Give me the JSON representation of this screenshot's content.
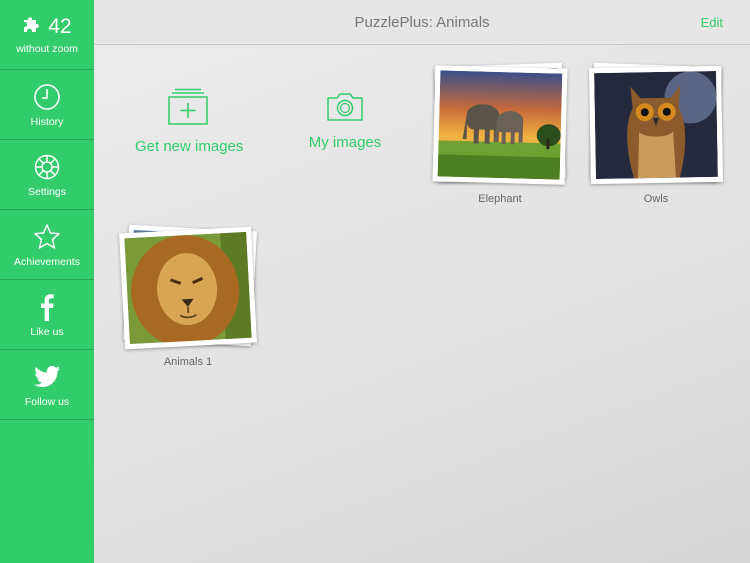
{
  "sidebar": {
    "score": {
      "value": "42",
      "label": "without zoom",
      "icon": "puzzle-piece-icon"
    },
    "items": [
      {
        "label": "History",
        "icon": "clock-icon"
      },
      {
        "label": "Settings",
        "icon": "gear-icon"
      },
      {
        "label": "Achievements",
        "icon": "star-icon"
      },
      {
        "label": "Like us",
        "icon": "facebook-icon"
      },
      {
        "label": "Follow us",
        "icon": "twitter-icon"
      }
    ],
    "color": "#33cc6a"
  },
  "header": {
    "title": "PuzzlePlus: Animals",
    "edit_label": "Edit"
  },
  "actions": {
    "get_new": {
      "label": "Get new images",
      "icon": "add-image-folder-icon"
    },
    "my_images": {
      "label": "My images",
      "icon": "camera-icon"
    }
  },
  "puzzles": [
    {
      "caption": "Elephant"
    },
    {
      "caption": "Owls"
    },
    {
      "caption": "Animals 1"
    }
  ],
  "accent": "#33cc6a"
}
